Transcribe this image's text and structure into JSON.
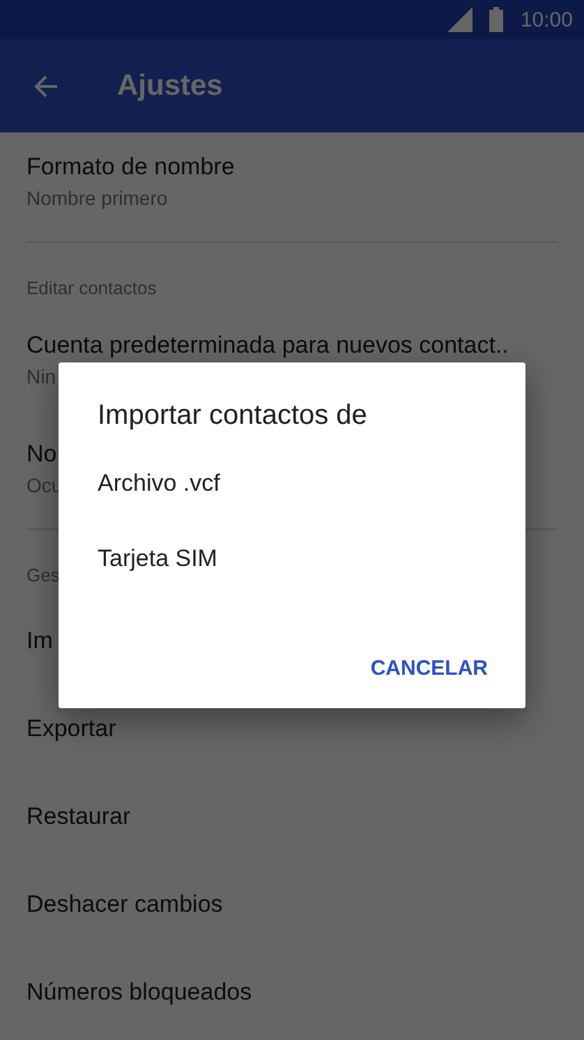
{
  "status_bar": {
    "time": "10:00"
  },
  "app_bar": {
    "title": "Ajustes"
  },
  "settings": [
    {
      "kind": "item",
      "title": "Formato de nombre",
      "subtitle": "Nombre primero"
    },
    {
      "kind": "divider"
    },
    {
      "kind": "section",
      "title": "Editar contactos"
    },
    {
      "kind": "item",
      "title": "Cuenta predeterminada para nuevos contact..",
      "subtitle": "Nin"
    },
    {
      "kind": "item",
      "title": "No",
      "subtitle": "Ocu"
    },
    {
      "kind": "divider"
    },
    {
      "kind": "section",
      "title": "Ges"
    },
    {
      "kind": "item",
      "title": "Im"
    },
    {
      "kind": "item",
      "title": "Exportar"
    },
    {
      "kind": "item",
      "title": "Restaurar"
    },
    {
      "kind": "item",
      "title": "Deshacer cambios"
    },
    {
      "kind": "item",
      "title": "Números bloqueados"
    }
  ],
  "dialog": {
    "title": "Importar contactos de",
    "options": [
      "Archivo .vcf",
      "Tarjeta SIM"
    ],
    "buttons": [
      "CANCELAR"
    ]
  }
}
